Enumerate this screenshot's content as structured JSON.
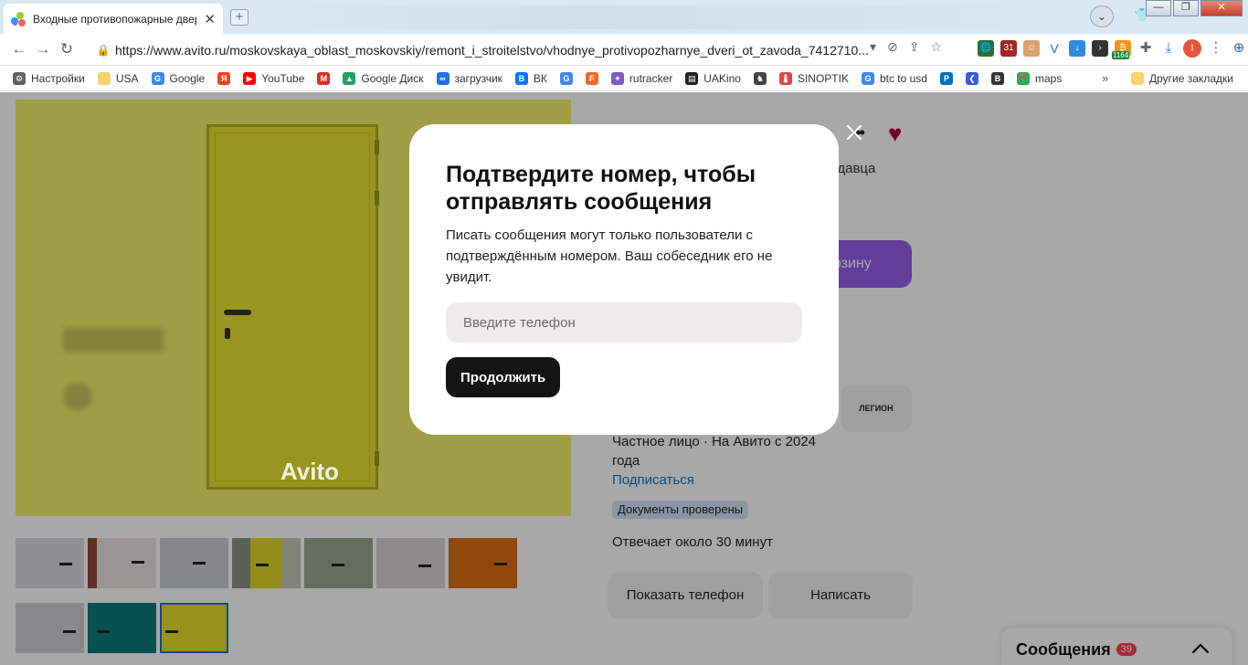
{
  "browser": {
    "tab_title": "Входные противопожарные двер",
    "tab_close": "✕",
    "new_tab": "+",
    "url": "https://www.avito.ru/moskovskaya_oblast_moskovskiy/remont_i_stroitelstvo/vhodnye_protivopozharnye_dveri_ot_zavoda_7412710...",
    "ext_badge": "1164",
    "avatar_letter": "I",
    "bookmarks": [
      {
        "label": "Настройки",
        "icon": "gear-icon",
        "color": "#5f6368"
      },
      {
        "label": "USA",
        "icon": "folder-icon",
        "color": "#f6d36b"
      },
      {
        "label": "Google",
        "icon": "google-icon",
        "color": "#4285f4"
      },
      {
        "label": "",
        "icon": "yandex-icon",
        "color": "#fc3f1d"
      },
      {
        "label": "YouTube",
        "icon": "youtube-icon",
        "color": "#ff0000"
      },
      {
        "label": "",
        "icon": "gmail-icon",
        "color": "#d93025"
      },
      {
        "label": "Google Диск",
        "icon": "drive-icon",
        "color": "#1fa463"
      },
      {
        "label": "загрузчик",
        "icon": "loader-icon",
        "color": "#1a73e8"
      },
      {
        "label": "ВК",
        "icon": "vk-icon",
        "color": "#0077ff"
      },
      {
        "label": "",
        "icon": "translate-icon",
        "color": "#4285f4"
      },
      {
        "label": "",
        "icon": "f-icon",
        "color": "#f06b2a"
      },
      {
        "label": "rutracker",
        "icon": "rutracker-icon",
        "color": "#7a5cc2"
      },
      {
        "label": "UAKino",
        "icon": "uakino-icon",
        "color": "#222222"
      },
      {
        "label": "",
        "icon": "chess-icon",
        "color": "#444444"
      },
      {
        "label": "SINOPTIK",
        "icon": "sinoptik-icon",
        "color": "#d94848"
      },
      {
        "label": "btc to usd",
        "icon": "google-icon",
        "color": "#4285f4"
      },
      {
        "label": "",
        "icon": "p-icon",
        "color": "#0070ba"
      },
      {
        "label": "",
        "icon": "arrow-icon",
        "color": "#3a5cd9"
      },
      {
        "label": "",
        "icon": "bc-icon",
        "color": "#333333"
      },
      {
        "label": "maps",
        "icon": "maps-icon",
        "color": "#34a853"
      }
    ],
    "bookmarks_more": "»",
    "bookmarks_other": "Другие закладки"
  },
  "listing": {
    "watermark": "Avito",
    "seller_text_fragment": "родавца",
    "cart_fragment": "орзину",
    "shop_logo": "ЛЕГИОН",
    "seller_type": "Частное лицо · На Авито с 2024 года",
    "subscribe": "Подписаться",
    "docs_badge": "Документы проверены",
    "response_time": "Отвечает около 30 минут",
    "show_phone_button": "Показать телефон",
    "write_button": "Написать"
  },
  "messages_widget": {
    "label": "Сообщения",
    "count": "39"
  },
  "modal": {
    "title": "Подтвердите номер, чтобы отправлять сообщения",
    "description": "Писать сообщения могут только пользователи с подтверждённым номером. Ваш собеседник его не увидит.",
    "phone_placeholder": "Введите телефон",
    "phone_value": "",
    "continue_button": "Продолжить"
  },
  "colors": {
    "accent_purple": "#965eeb",
    "link_blue": "#0a76c9",
    "heart": "#b0003a",
    "door_yellow": "#e8e233"
  }
}
